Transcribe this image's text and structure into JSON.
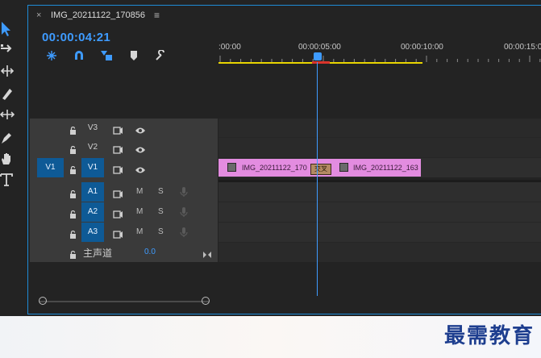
{
  "tab": {
    "close": "×",
    "title": "IMG_20211122_170856",
    "menu": "≡"
  },
  "timecode": "00:00:04:21",
  "ruler": {
    "labels": [
      ":00:00",
      "00:00:05:00",
      "00:00:10:00",
      "00:00:15:0"
    ]
  },
  "tracks": {
    "video": [
      {
        "name": "V3",
        "source": ""
      },
      {
        "name": "V2",
        "source": ""
      },
      {
        "name": "V1",
        "source": "V1"
      }
    ],
    "audio": [
      {
        "name": "A1",
        "m": "M",
        "s": "S"
      },
      {
        "name": "A2",
        "m": "M",
        "s": "S"
      },
      {
        "name": "A3",
        "m": "M",
        "s": "S"
      }
    ],
    "master": {
      "label": "主声道",
      "value": "0.0"
    }
  },
  "clips": [
    {
      "label": "IMG_20211122_170"
    },
    {
      "label": "IMG_20211122_163"
    }
  ],
  "transition": {
    "label": "交叉"
  },
  "logo": "最需教育",
  "colors": {
    "accent": "#3e9bff",
    "clip": "#e38ce0",
    "target": "#0e5a96",
    "workarea": "#e8d400"
  }
}
